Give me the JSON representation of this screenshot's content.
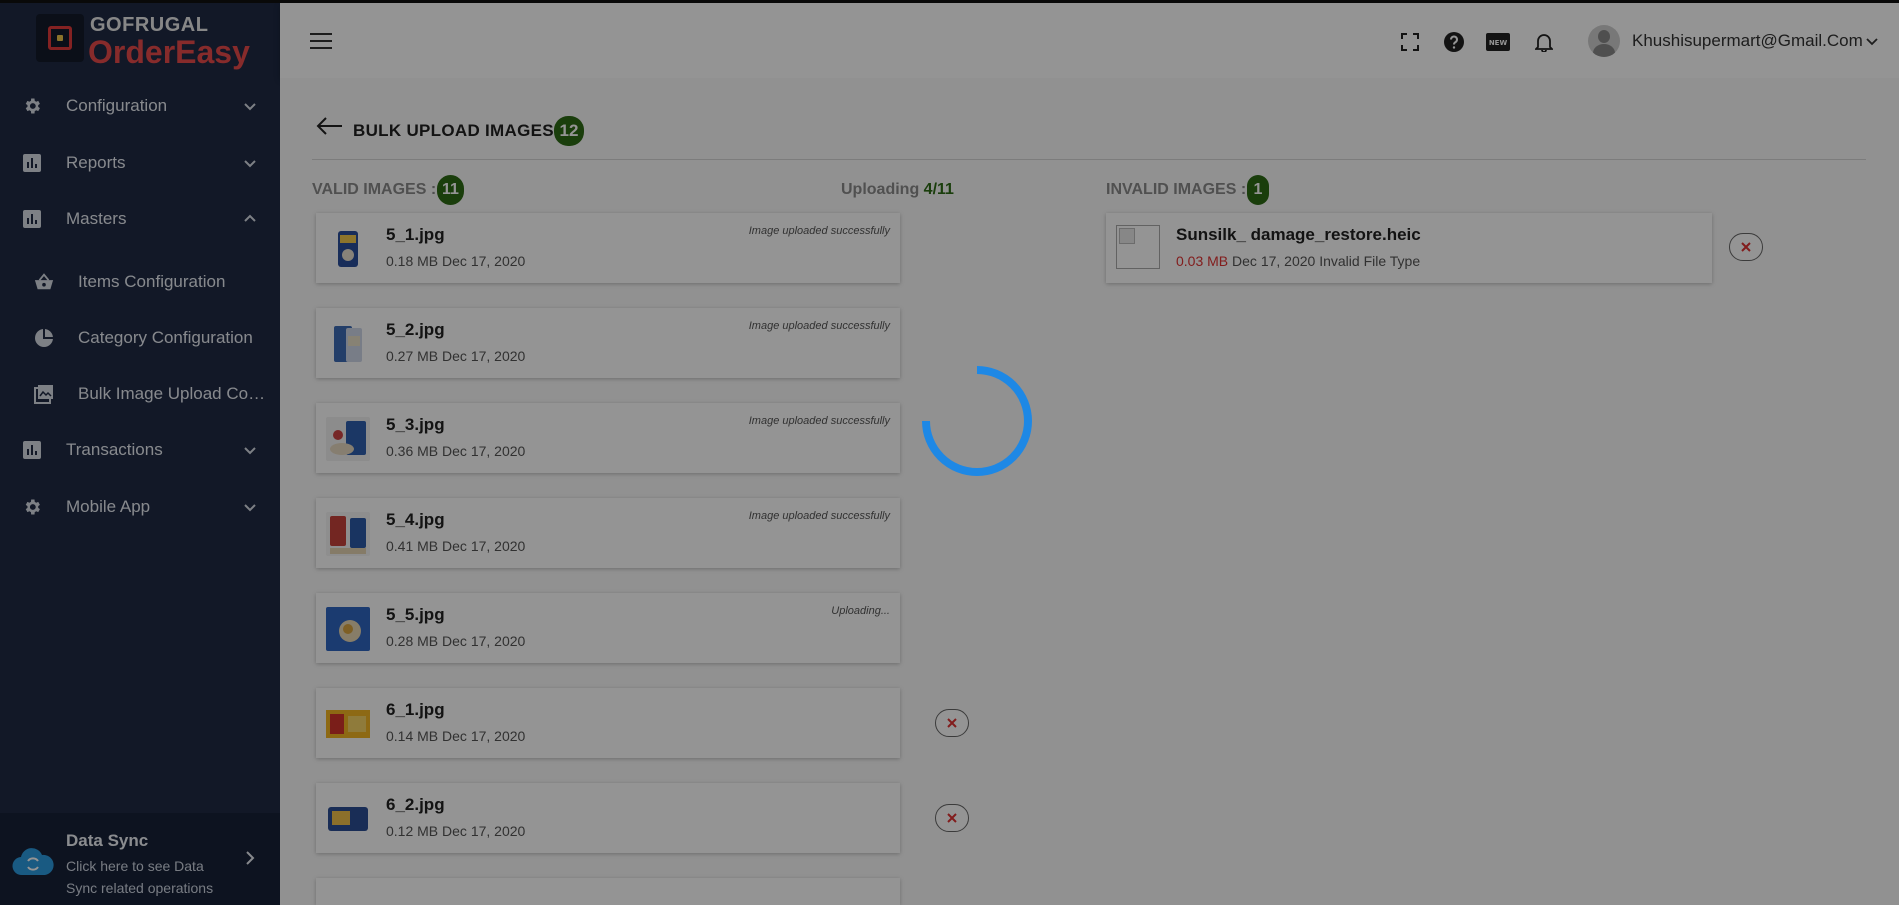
{
  "app": {
    "logo_top": "GOFRUGAL",
    "logo_bottom": "OrderEasy"
  },
  "colors": {
    "sidebar_bg": "#1f2a44",
    "accent_green": "#2e6b16",
    "error_red": "#e03333",
    "spinner_blue": "#1e88e5"
  },
  "sidebar": {
    "items": [
      {
        "label": "Configuration",
        "icon": "gear-icon",
        "expanded": false
      },
      {
        "label": "Reports",
        "icon": "bar-chart-icon",
        "expanded": false
      },
      {
        "label": "Masters",
        "icon": "bar-chart-icon",
        "expanded": true
      },
      {
        "label": "Transactions",
        "icon": "bar-chart-icon",
        "expanded": false
      },
      {
        "label": "Mobile App",
        "icon": "gear-icon",
        "expanded": false
      }
    ],
    "sub_items": [
      {
        "label": "Items Configuration",
        "icon": "basket-icon"
      },
      {
        "label": "Category Configuration",
        "icon": "pie-chart-icon"
      },
      {
        "label": "Bulk Image Upload Con...",
        "icon": "images-icon"
      }
    ],
    "data_sync": {
      "title": "Data Sync",
      "text": "Click here to see Data Sync related operations"
    }
  },
  "header": {
    "user_email": "Khushisupermart@Gmail.Com",
    "icons": [
      "fullscreen-icon",
      "help-icon",
      "new-badge-icon",
      "bell-icon"
    ]
  },
  "page": {
    "title": "BULK UPLOAD IMAGES :",
    "total_count": "12",
    "valid_label": "VALID IMAGES :",
    "valid_count": "11",
    "uploading_label": "Uploading",
    "uploading_progress": "4/11",
    "invalid_label": "INVALID IMAGES :",
    "invalid_count": "1"
  },
  "valid_images": [
    {
      "name": "5_1.jpg",
      "size": "0.18 MB",
      "date": "Dec 17, 2020",
      "status": "Image uploaded successfully"
    },
    {
      "name": "5_2.jpg",
      "size": "0.27 MB",
      "date": "Dec 17, 2020",
      "status": "Image uploaded successfully"
    },
    {
      "name": "5_3.jpg",
      "size": "0.36 MB",
      "date": "Dec 17, 2020",
      "status": "Image uploaded successfully"
    },
    {
      "name": "5_4.jpg",
      "size": "0.41 MB",
      "date": "Dec 17, 2020",
      "status": "Image uploaded successfully"
    },
    {
      "name": "5_5.jpg",
      "size": "0.28 MB",
      "date": "Dec 17, 2020",
      "status": "Uploading..."
    },
    {
      "name": "6_1.jpg",
      "size": "0.14 MB",
      "date": "Dec 17, 2020",
      "status": ""
    },
    {
      "name": "6_2.jpg",
      "size": "0.12 MB",
      "date": "Dec 17, 2020",
      "status": ""
    }
  ],
  "invalid_images": [
    {
      "name": "Sunsilk_ damage_restore.heic",
      "size": "0.03 MB",
      "date": "Dec 17, 2020",
      "reason": "Invalid File Type"
    }
  ]
}
